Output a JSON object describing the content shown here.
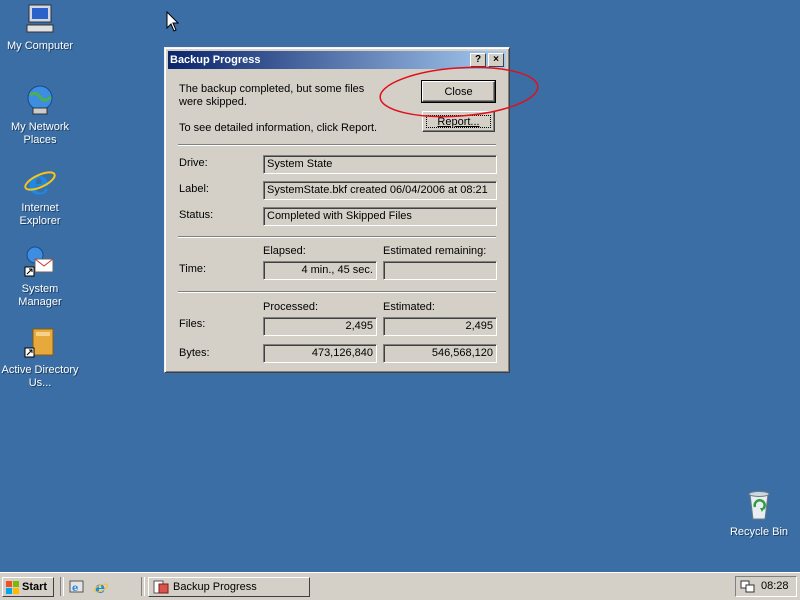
{
  "desktop": {
    "icons": [
      {
        "label": "My Computer",
        "icon": "my-computer-icon"
      },
      {
        "label": "My Network Places",
        "icon": "network-places-icon"
      },
      {
        "label": "Internet Explorer",
        "icon": "internet-explorer-icon"
      },
      {
        "label": "System Manager",
        "icon": "system-manager-icon"
      },
      {
        "label": "Active Directory Us...",
        "icon": "active-directory-icon"
      },
      {
        "label": "Recycle Bin",
        "icon": "recycle-bin-icon"
      }
    ]
  },
  "dialog": {
    "title": "Backup Progress",
    "help_button": "?",
    "close_x": "×",
    "message": "The backup completed, but some files were skipped.",
    "report_hint": "To see detailed information, click Report.",
    "close_button": "Close",
    "report_button": "Report...",
    "drive_label": "Drive:",
    "drive_value": "System State",
    "label_label": "Label:",
    "label_value": "SystemState.bkf created 06/04/2006 at 08:21",
    "status_label": "Status:",
    "status_value": "Completed with Skipped Files",
    "time_label": "Time:",
    "elapsed_header": "Elapsed:",
    "elapsed_value": "4 min., 45 sec.",
    "remaining_header": "Estimated remaining:",
    "remaining_value": "",
    "processed_header": "Processed:",
    "estimated_header": "Estimated:",
    "files_label": "Files:",
    "files_processed": "2,495",
    "files_estimated": "2,495",
    "bytes_label": "Bytes:",
    "bytes_processed": "473,126,840",
    "bytes_estimated": "546,568,120"
  },
  "annotation": {
    "color": "#e0101a",
    "shape": "ellipse around Close button"
  },
  "taskbar": {
    "start_label": "Start",
    "task_label": "Backup Progress",
    "clock": "08:28"
  }
}
